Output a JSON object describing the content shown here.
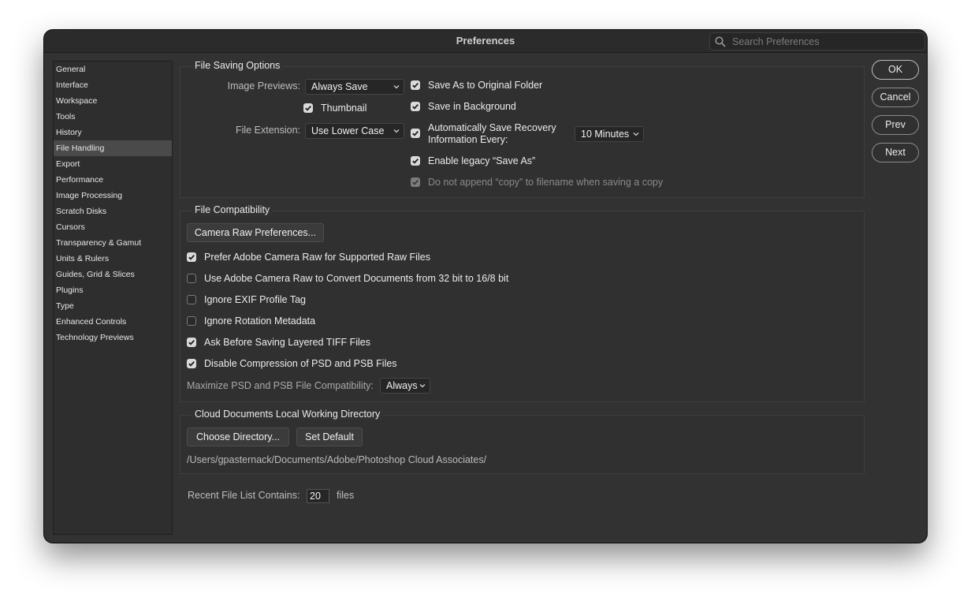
{
  "window": {
    "title": "Preferences"
  },
  "search": {
    "placeholder": "Search Preferences"
  },
  "sidebar": {
    "items": [
      {
        "label": "General"
      },
      {
        "label": "Interface"
      },
      {
        "label": "Workspace"
      },
      {
        "label": "Tools"
      },
      {
        "label": "History"
      },
      {
        "label": "File Handling"
      },
      {
        "label": "Export"
      },
      {
        "label": "Performance"
      },
      {
        "label": "Image Processing"
      },
      {
        "label": "Scratch Disks"
      },
      {
        "label": "Cursors"
      },
      {
        "label": "Transparency & Gamut"
      },
      {
        "label": "Units & Rulers"
      },
      {
        "label": "Guides, Grid & Slices"
      },
      {
        "label": "Plugins"
      },
      {
        "label": "Type"
      },
      {
        "label": "Enhanced Controls"
      },
      {
        "label": "Technology Previews"
      }
    ],
    "selected": "File Handling"
  },
  "file_saving": {
    "title": "File Saving Options",
    "image_previews_label": "Image Previews:",
    "image_previews_value": "Always Save",
    "thumbnail_label": "Thumbnail",
    "thumbnail_checked": true,
    "file_extension_label": "File Extension:",
    "file_extension_value": "Use Lower Case",
    "save_as_original_label": "Save As to Original Folder",
    "save_in_background_label": "Save in Background",
    "auto_save_line1": "Automatically Save Recovery",
    "auto_save_line2": "Information Every:",
    "auto_save_interval": "10 Minutes",
    "legacy_save_as_label": "Enable legacy “Save As”",
    "no_copy_label": "Do not append “copy” to filename when saving a copy"
  },
  "file_compat": {
    "title": "File Compatibility",
    "camera_raw_button": "Camera Raw Preferences...",
    "options": [
      {
        "label": "Prefer Adobe Camera Raw for Supported Raw Files",
        "checked": true
      },
      {
        "label": "Use Adobe Camera Raw to Convert Documents from 32 bit to 16/8 bit",
        "checked": false
      },
      {
        "label": "Ignore EXIF Profile Tag",
        "checked": false
      },
      {
        "label": "Ignore Rotation Metadata",
        "checked": false
      },
      {
        "label": "Ask Before Saving Layered TIFF Files",
        "checked": true
      },
      {
        "label": "Disable Compression of PSD and PSB Files",
        "checked": true
      }
    ],
    "maximize_label": "Maximize PSD and PSB File Compatibility:",
    "maximize_value": "Always"
  },
  "cloud": {
    "title": "Cloud Documents Local Working Directory",
    "choose_button": "Choose Directory...",
    "default_button": "Set Default",
    "path": "/Users/gpasternack/Documents/Adobe/Photoshop Cloud Associates/"
  },
  "recent": {
    "label": "Recent File List Contains:",
    "value": "20",
    "suffix": "files"
  },
  "buttons": {
    "ok": "OK",
    "cancel": "Cancel",
    "prev": "Prev",
    "next": "Next"
  }
}
